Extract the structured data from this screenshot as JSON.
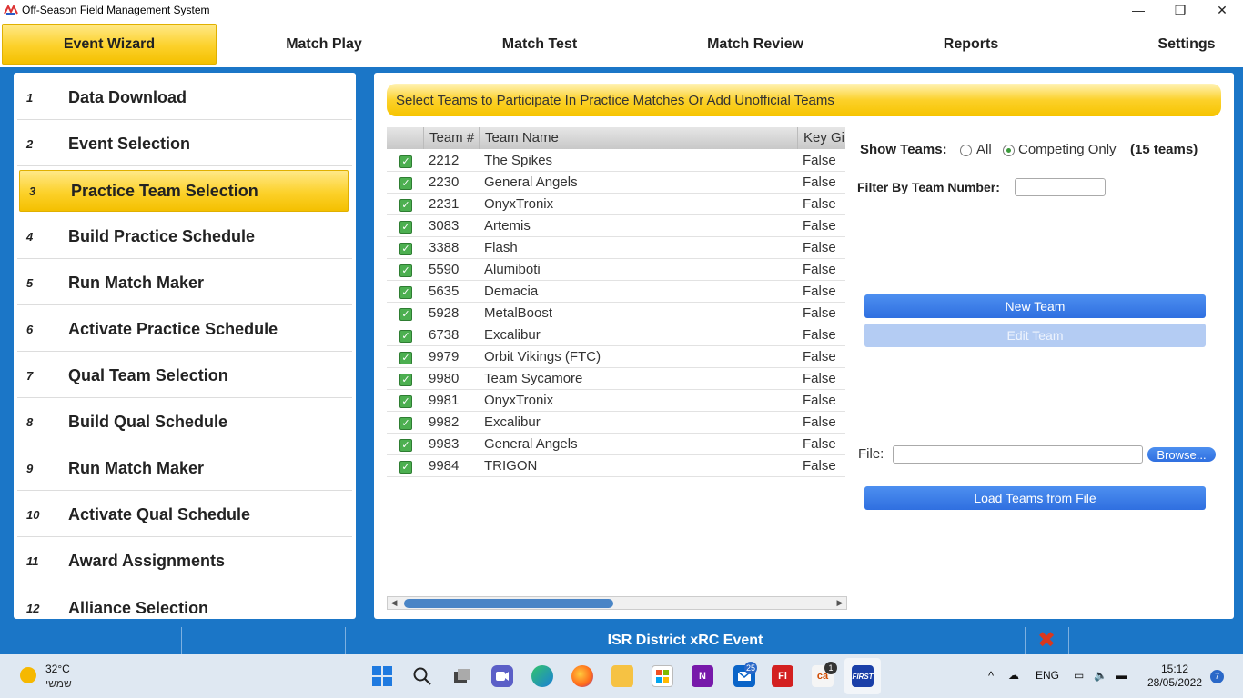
{
  "window": {
    "title": "Off-Season Field Management System",
    "controls": {
      "minimize": "—",
      "restore": "❐",
      "close": "✕"
    }
  },
  "nav": {
    "tabs": [
      {
        "label": "Event Wizard",
        "active": true
      },
      {
        "label": "Match Play"
      },
      {
        "label": "Match Test"
      },
      {
        "label": "Match Review"
      },
      {
        "label": "Reports"
      },
      {
        "label": "Settings"
      }
    ]
  },
  "wizard": {
    "steps": [
      {
        "num": "1",
        "label": "Data Download"
      },
      {
        "num": "2",
        "label": "Event Selection"
      },
      {
        "num": "3",
        "label": "Practice Team Selection",
        "active": true
      },
      {
        "num": "4",
        "label": "Build Practice Schedule"
      },
      {
        "num": "5",
        "label": "Run Match Maker"
      },
      {
        "num": "6",
        "label": "Activate Practice Schedule"
      },
      {
        "num": "7",
        "label": "Qual Team Selection"
      },
      {
        "num": "8",
        "label": "Build Qual Schedule"
      },
      {
        "num": "9",
        "label": "Run Match Maker"
      },
      {
        "num": "10",
        "label": "Activate Qual Schedule"
      },
      {
        "num": "11",
        "label": "Award Assignments"
      },
      {
        "num": "12",
        "label": "Alliance Selection"
      }
    ]
  },
  "main": {
    "banner": "Select Teams to Participate In Practice Matches Or Add Unofficial Teams",
    "table": {
      "headers": [
        "",
        "Team #",
        "Team Name",
        "Key Gi"
      ],
      "rows": [
        {
          "team": "2212",
          "name": "The Spikes",
          "key": "False"
        },
        {
          "team": "2230",
          "name": "General Angels",
          "key": "False"
        },
        {
          "team": "2231",
          "name": "OnyxTronix",
          "key": "False"
        },
        {
          "team": "3083",
          "name": "Artemis",
          "key": "False"
        },
        {
          "team": "3388",
          "name": "Flash",
          "key": "False"
        },
        {
          "team": "5590",
          "name": "Alumiboti",
          "key": "False"
        },
        {
          "team": "5635",
          "name": "Demacia",
          "key": "False"
        },
        {
          "team": "5928",
          "name": "MetalBoost",
          "key": "False"
        },
        {
          "team": "6738",
          "name": "Excalibur",
          "key": "False"
        },
        {
          "team": "9979",
          "name": "Orbit Vikings (FTC)",
          "key": "False"
        },
        {
          "team": "9980",
          "name": "Team Sycamore",
          "key": "False"
        },
        {
          "team": "9981",
          "name": "OnyxTronix",
          "key": "False"
        },
        {
          "team": "9982",
          "name": "Excalibur",
          "key": "False"
        },
        {
          "team": "9983",
          "name": "General Angels",
          "key": "False"
        },
        {
          "team": "9984",
          "name": "TRIGON",
          "key": "False"
        }
      ]
    },
    "show_teams": {
      "label": "Show Teams:",
      "option_all": "All",
      "option_competing": "Competing Only",
      "selected": "Competing Only",
      "count": "(15 teams)"
    },
    "filter": {
      "label": "Filter By Team Number:",
      "value": ""
    },
    "buttons": {
      "new_team": "New Team",
      "edit_team": "Edit Team",
      "browse": "Browse...",
      "load_file": "Load Teams from File"
    },
    "file": {
      "label": "File:",
      "value": ""
    }
  },
  "statusbar": {
    "event_name": "ISR District xRC Event"
  },
  "taskbar": {
    "weather_temp": "32°C",
    "weather_desc": "שמשי",
    "language": "ENG",
    "time": "15:12",
    "date": "28/05/2022",
    "notification_count": "7",
    "badges": {
      "mail": "25",
      "app": "1"
    },
    "app_labels": {
      "fl": "Fl",
      "ca": "ca",
      "first": "FIRST"
    }
  }
}
